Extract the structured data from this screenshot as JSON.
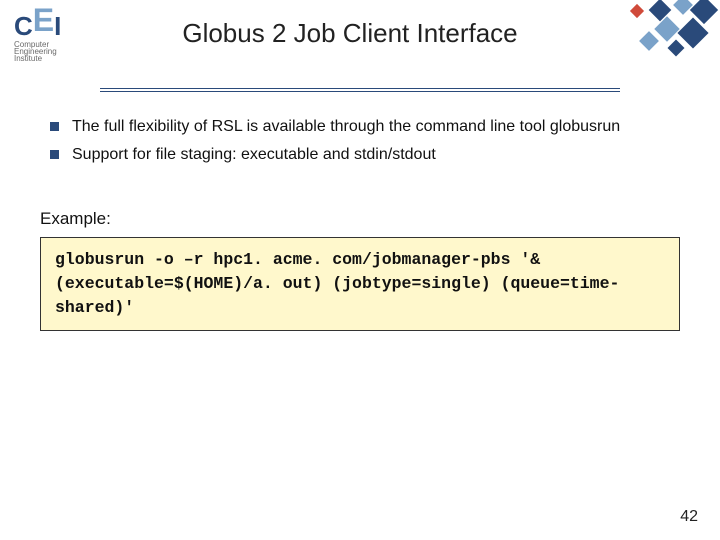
{
  "logo": {
    "letters": {
      "c": "C",
      "e": "E",
      "i": "I"
    },
    "sub1": "Computer",
    "sub2": "Engineering",
    "sub3": "Institute"
  },
  "title": "Globus 2 Job Client Interface",
  "bullets": [
    "The full flexibility of RSL is available through the command line tool globusrun",
    "Support for file staging:  executable and stdin/stdout"
  ],
  "example_label": "Example:",
  "code": "globusrun -o –r hpc1. acme. com/jobmanager-pbs '&(executable=$(HOME)/a. out) (jobtype=single) (queue=time-shared)'",
  "page_number": "42",
  "colors": {
    "accent": "#2a4a7a",
    "light": "#7aa2c9",
    "red": "#d04a3a",
    "codebg": "#fff8cc"
  }
}
